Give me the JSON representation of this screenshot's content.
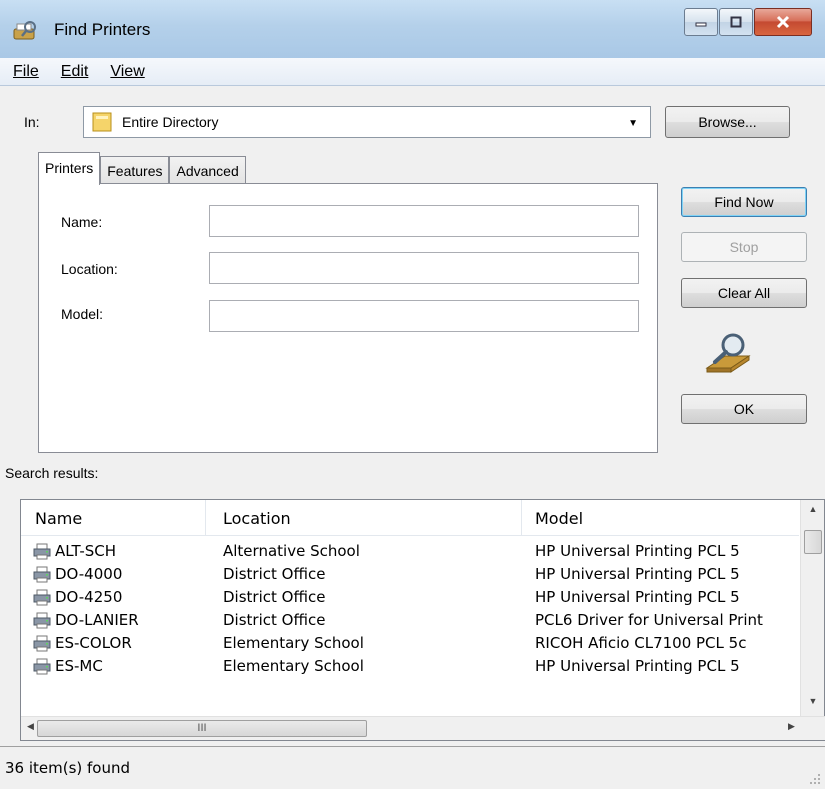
{
  "window": {
    "title": "Find Printers"
  },
  "menu": {
    "items": [
      {
        "label": "File"
      },
      {
        "label": "Edit"
      },
      {
        "label": "View"
      }
    ]
  },
  "scope": {
    "label": "In:",
    "value": "Entire Directory",
    "browse_label": "Browse..."
  },
  "tabs": [
    {
      "label": "Printers",
      "active": true
    },
    {
      "label": "Features",
      "active": false
    },
    {
      "label": "Advanced",
      "active": false
    }
  ],
  "fields": {
    "name": {
      "label": "Name:",
      "value": ""
    },
    "location": {
      "label": "Location:",
      "value": ""
    },
    "model": {
      "label": "Model:",
      "value": ""
    }
  },
  "actions": {
    "find_now": "Find Now",
    "stop": "Stop",
    "clear_all": "Clear All",
    "ok": "OK"
  },
  "results": {
    "label": "Search results:",
    "columns": [
      "Name",
      "Location",
      "Model"
    ],
    "rows": [
      {
        "name": "ALT-SCH",
        "location": "Alternative School",
        "model": "HP Universal Printing PCL 5"
      },
      {
        "name": "DO-4000",
        "location": "District Office",
        "model": "HP Universal Printing PCL 5"
      },
      {
        "name": "DO-4250",
        "location": "District Office",
        "model": "HP Universal Printing PCL 5"
      },
      {
        "name": "DO-LANIER",
        "location": "District Office",
        "model": "PCL6 Driver for Universal Print"
      },
      {
        "name": "ES-COLOR",
        "location": "Elementary School",
        "model": "RICOH Aficio CL7100 PCL 5c"
      },
      {
        "name": "ES-MC",
        "location": "Elementary School",
        "model": "HP Universal Printing PCL 5"
      }
    ],
    "hscroll_grip": "III"
  },
  "status": {
    "text": "36 item(s) found"
  }
}
